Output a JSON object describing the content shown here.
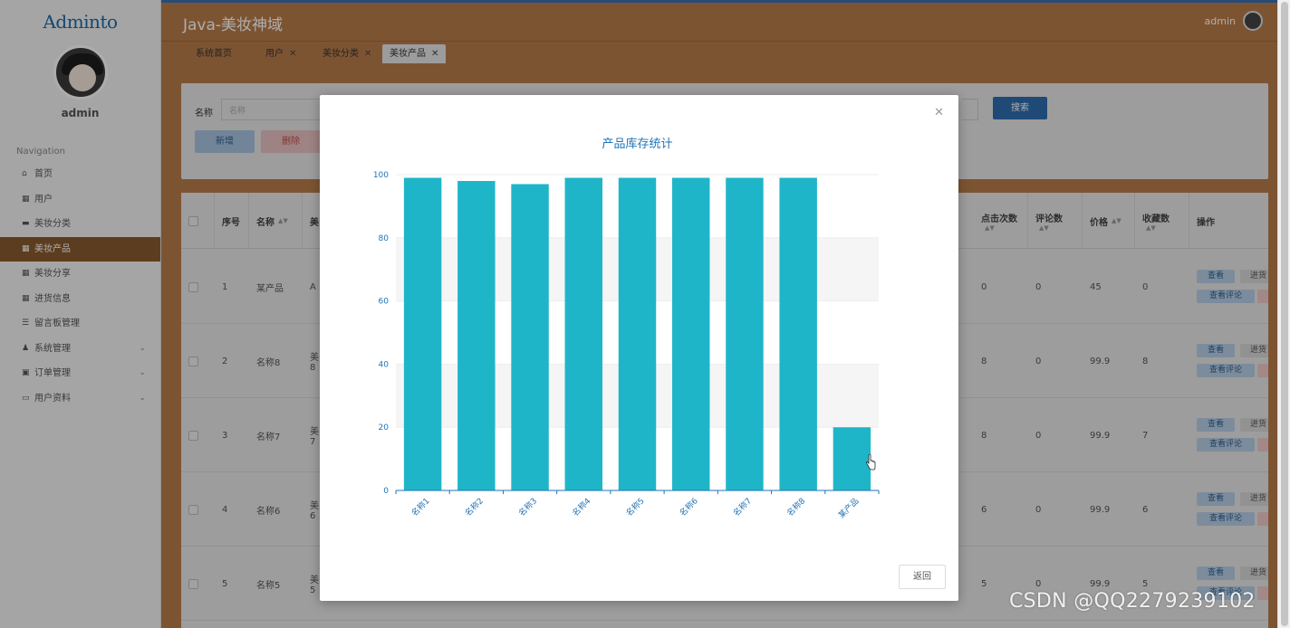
{
  "sidebar": {
    "logo": "Adminto",
    "username": "admin",
    "nav_title": "Navigation",
    "items": [
      {
        "label": "首页",
        "icon": "home-icon",
        "glyph": "⌂"
      },
      {
        "label": "用户",
        "icon": "grid-icon",
        "glyph": "▦"
      },
      {
        "label": "美妆分类",
        "icon": "folder-icon",
        "glyph": "▬"
      },
      {
        "label": "美妆产品",
        "icon": "grid-icon",
        "glyph": "▦"
      },
      {
        "label": "美妆分享",
        "icon": "grid-icon",
        "glyph": "▦"
      },
      {
        "label": "进货信息",
        "icon": "grid-icon",
        "glyph": "▦"
      },
      {
        "label": "留言板管理",
        "icon": "list-icon",
        "glyph": "☰"
      },
      {
        "label": "系统管理",
        "icon": "user-icon",
        "glyph": "♟"
      },
      {
        "label": "订单管理",
        "icon": "briefcase-icon",
        "glyph": "▣"
      },
      {
        "label": "用户资料",
        "icon": "card-icon",
        "glyph": "▭"
      }
    ]
  },
  "header": {
    "title": "Java-美妆神域",
    "user": "admin"
  },
  "tabs": [
    {
      "label": "系统首页",
      "closable": false
    },
    {
      "label": "用户",
      "closable": true
    },
    {
      "label": "美妆分类",
      "closable": true
    },
    {
      "label": "美妆产品",
      "closable": true
    }
  ],
  "search": {
    "label": "名称",
    "placeholder": "名称",
    "search_button": "搜索",
    "add_button": "新增",
    "delete_button": "删除"
  },
  "table": {
    "headers": {
      "index": "序号",
      "name": "名称",
      "beauty": "美",
      "clicks": "点击次数",
      "comments": "评论数",
      "price": "价格",
      "favorites": "收藏数",
      "actions": "操作"
    },
    "rows": [
      {
        "index": "1",
        "name": "某产品",
        "beauty": "A",
        "beauty2": "",
        "clicks": "0",
        "comments": "0",
        "price": "45",
        "favorites": "0"
      },
      {
        "index": "2",
        "name": "名称8",
        "beauty": "美",
        "beauty2": "8",
        "clicks": "8",
        "comments": "0",
        "price": "99.9",
        "favorites": "8"
      },
      {
        "index": "3",
        "name": "名称7",
        "beauty": "美",
        "beauty2": "7",
        "clicks": "8",
        "comments": "0",
        "price": "99.9",
        "favorites": "7"
      },
      {
        "index": "4",
        "name": "名称6",
        "beauty": "美",
        "beauty2": "6",
        "clicks": "6",
        "comments": "0",
        "price": "99.9",
        "favorites": "6"
      },
      {
        "index": "5",
        "name": "名称5",
        "beauty": "美",
        "beauty2": "5",
        "clicks": "5",
        "comments": "0",
        "price": "99.9",
        "favorites": "5"
      }
    ],
    "actions": {
      "view": "查看",
      "stock": "进货",
      "view_comments": "查看评论",
      "view_comments_short": "查看评论"
    }
  },
  "modal": {
    "back_button": "返回"
  },
  "chart_data": {
    "type": "bar",
    "title": "产品库存统计",
    "categories": [
      "名称1",
      "名称2",
      "名称3",
      "名称4",
      "名称5",
      "名称6",
      "名称7",
      "名称8",
      "某产品"
    ],
    "values": [
      99,
      98,
      97,
      99,
      99,
      99,
      99,
      99,
      20
    ],
    "ylim": [
      0,
      100
    ],
    "yticks": [
      0,
      20,
      40,
      60,
      80,
      100
    ],
    "bar_color": "#1fb5c9",
    "axis_color": "#1f73b7",
    "grid": "alternating bands"
  },
  "watermark": "CSDN @QQ2279239102",
  "colors": {
    "header": "#b97d4b",
    "active_nav": "#8a5a2e",
    "primary": "#2f6eb0"
  }
}
